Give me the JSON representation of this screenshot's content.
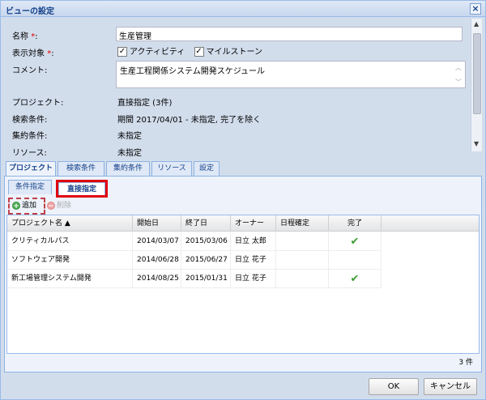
{
  "window": {
    "title": "ビューの設定",
    "close_glyph": "×"
  },
  "form": {
    "name_label": "名称",
    "required_mark": "*",
    "name_value": "生産管理",
    "display_label": "表示対象",
    "checkbox_activity": {
      "label": "アクティビティ",
      "checked": true
    },
    "checkbox_milestone": {
      "label": "マイルストーン",
      "checked": true
    },
    "comment_label": "コメント:",
    "comment_value": "生産工程関係システム開発スケジュール",
    "project_label": "プロジェクト:",
    "project_value": "直接指定 (3件)",
    "search_label": "検索条件:",
    "search_value": "期間 2017/04/01 - 未指定, 完了を除く",
    "aggregate_label": "集約条件:",
    "aggregate_value": "未指定",
    "resource_label": "リソース:",
    "resource_value": "未指定"
  },
  "tabs": [
    {
      "label": "プロジェクト",
      "active": true
    },
    {
      "label": "検索条件",
      "active": false
    },
    {
      "label": "集約条件",
      "active": false
    },
    {
      "label": "リソース",
      "active": false
    },
    {
      "label": "設定",
      "active": false
    }
  ],
  "subtabs": [
    {
      "label": "条件指定",
      "active": false
    },
    {
      "label": "直接指定",
      "active": true
    }
  ],
  "toolbar": {
    "add_label": "追加",
    "delete_label": "削除",
    "add_icon": "plus-circle-icon",
    "delete_icon": "minus-circle-icon"
  },
  "grid": {
    "columns": [
      "プロジェクト名 ▲",
      "開始日",
      "終了日",
      "オーナー",
      "日程確定",
      "完了"
    ],
    "rows": [
      {
        "name": "クリティカルパス",
        "start": "2014/03/07",
        "end": "2015/03/06",
        "owner": "日立 太郎",
        "fixed": "",
        "done": true
      },
      {
        "name": "ソフトウェア開発",
        "start": "2014/06/28",
        "end": "2015/06/27",
        "owner": "日立 花子",
        "fixed": "",
        "done": false
      },
      {
        "name": "新工場管理システム開発",
        "start": "2014/08/25",
        "end": "2015/01/31",
        "owner": "日立 花子",
        "fixed": "",
        "done": true
      }
    ],
    "count": "3 件"
  },
  "buttons": {
    "ok": "OK",
    "cancel": "キャンセル"
  },
  "colors": {
    "accent": "#15428b",
    "highlight": "#e00010",
    "check": "#3f9b33"
  }
}
